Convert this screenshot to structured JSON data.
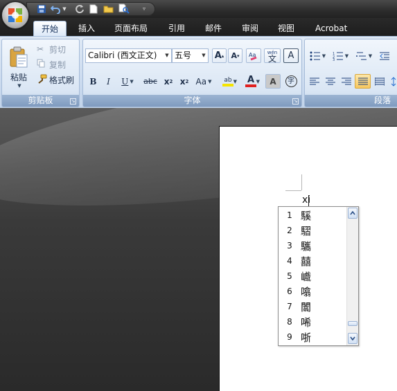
{
  "quick_access": {
    "icons": [
      "save-icon",
      "undo-icon",
      "redo-icon",
      "new-document-icon",
      "open-folder-icon",
      "print-preview-icon",
      "customize-qat-icon"
    ]
  },
  "tabs": [
    {
      "label": "开始",
      "active": true
    },
    {
      "label": "插入"
    },
    {
      "label": "页面布局"
    },
    {
      "label": "引用"
    },
    {
      "label": "邮件"
    },
    {
      "label": "审阅"
    },
    {
      "label": "视图"
    },
    {
      "label": "Acrobat"
    }
  ],
  "clipboard": {
    "caption": "剪贴板",
    "paste_label": "粘贴",
    "cut_label": "剪切",
    "copy_label": "复制",
    "format_painter_label": "格式刷"
  },
  "font": {
    "caption": "字体",
    "font_name": "Calibri (西文正文)",
    "font_size": "五号",
    "bold": "B",
    "italic": "I",
    "underline": "U",
    "strikethrough": "abc",
    "subscript": "x",
    "superscript": "x",
    "subscript_digit": "2",
    "superscript_digit": "2",
    "change_case": "Aa",
    "grow_font": "A",
    "shrink_font": "A",
    "font_color_letter": "A",
    "char_shading_letter": "A",
    "enclose_char": "字",
    "phonetic_text": "文",
    "char_border_letter": "A",
    "highlight_letters": "ab"
  },
  "paragraph": {
    "caption": "段落"
  },
  "ime": {
    "composition": "xi",
    "candidates": [
      {
        "num": "1",
        "char": "騱"
      },
      {
        "num": "2",
        "char": "騽"
      },
      {
        "num": "3",
        "char": "驨"
      },
      {
        "num": "4",
        "char": "囍"
      },
      {
        "num": "5",
        "char": "巇"
      },
      {
        "num": "6",
        "char": "噏"
      },
      {
        "num": "7",
        "char": "闟"
      },
      {
        "num": "8",
        "char": "唏"
      },
      {
        "num": "9",
        "char": "哳"
      }
    ]
  },
  "colors": {
    "accent_blue": "#1e3f7a",
    "ribbon": "#dbe6f4",
    "font_color_red": "#e02020",
    "highlight_yellow": "#f5e400"
  }
}
